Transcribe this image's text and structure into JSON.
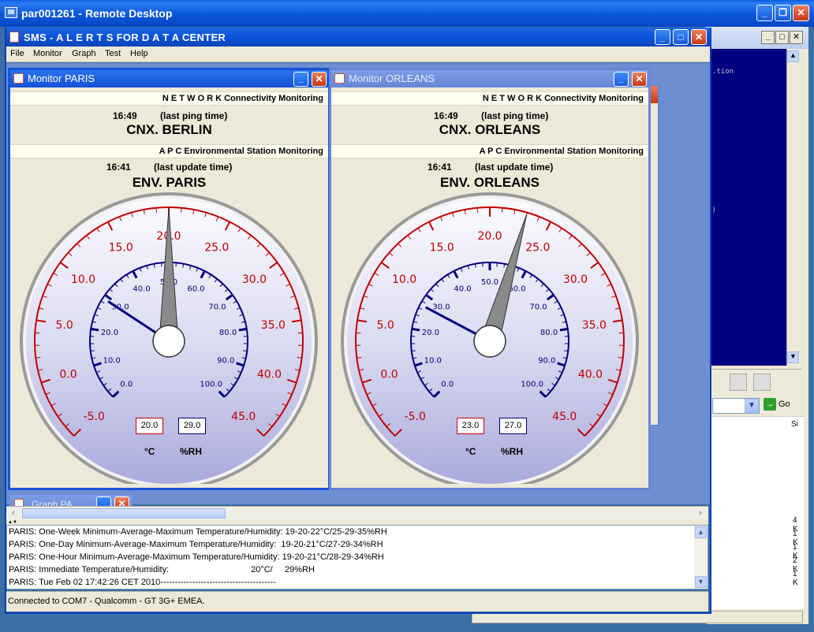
{
  "remote_desktop": {
    "title": "par001261 - Remote Desktop",
    "minimize": "_",
    "restore": "❐",
    "close": "✕"
  },
  "app": {
    "title": "SMS - A L E R T S  FOR  D A T A CENTER",
    "minimize": "_",
    "maximize": "□",
    "close": "✕",
    "menu": [
      "File",
      "Monitor",
      "Graph",
      "Test",
      "Help"
    ]
  },
  "monitors": [
    {
      "title": "Monitor PARIS",
      "network_band": "N E T W O R K  Connectivity Monitoring",
      "ping_time": "16:49",
      "ping_caption": "(last ping time)",
      "cnx_label": "CNX. BERLIN",
      "apc_band": "A P C  Environmental Station  Monitoring",
      "update_time": "16:41",
      "update_caption": "(last update time)",
      "env_label": "ENV. PARIS",
      "temperature": 20.0,
      "humidity": 29.0,
      "temperature_text": "20.0",
      "humidity_text": "29.0",
      "temp_unit": "°C",
      "hum_unit": "%RH"
    },
    {
      "title": "Monitor ORLEANS",
      "network_band": "N E T W O R K  Connectivity Monitoring",
      "ping_time": "16:49",
      "ping_caption": "(last ping time)",
      "cnx_label": "CNX. ORLEANS",
      "apc_band": "A P C  Environmental Station  Monitoring",
      "update_time": "16:41",
      "update_caption": "(last update time)",
      "env_label": "ENV. ORLEANS",
      "temperature": 23.0,
      "humidity": 27.0,
      "temperature_text": "23.0",
      "humidity_text": "27.0",
      "temp_unit": "°C",
      "hum_unit": "%RH"
    }
  ],
  "gauge_scales": {
    "temperature_labels": [
      "-5.0",
      "0.0",
      "5.0",
      "10.0",
      "15.0",
      "20.0",
      "25.0",
      "30.0",
      "35.0",
      "40.0",
      "45.0"
    ],
    "humidity_labels": [
      "0.0",
      "10.0",
      "20.0",
      "30.0",
      "40.0",
      "50.0",
      "60.0",
      "70.0",
      "80.0",
      "90.0",
      "100.0"
    ]
  },
  "graph_frame": {
    "title": "Graph PA"
  },
  "log": {
    "lines": [
      "PARIS: One-Week Minimum-Average-Maximum Temperature/Humidity: 19-20-22°C/25-29-35%RH",
      "PARIS: One-Day Minimum-Average-Maximum Temperature/Humidity:  19-20-21°C/27-29-34%RH",
      "PARIS: One-Hour Minimum-Average-Maximum Temperature/Humidity: 19-20-21°C/28-29-34%RH",
      "PARIS: Immediate Temperature/Humidity:                                  20°C/     29%RH",
      "PARIS: Tue Feb 02 17:42:26 CET 2010----------------------------------------"
    ]
  },
  "status": "Connected to COM7 - Qualcomm - GT 3G+ EMEA.",
  "background_app": {
    "console_lines": [
      ".tion",
      "e)"
    ],
    "go_label": "Go",
    "column_header": "Si",
    "list_items": [
      "4 K",
      "1 K",
      "1 K",
      "2 K",
      "1 K"
    ]
  },
  "colors": {
    "temp_red": "#c00000",
    "hum_blue": "#00007a",
    "title_blue": "#0b4fd4",
    "xp_face": "#ece9d8"
  }
}
